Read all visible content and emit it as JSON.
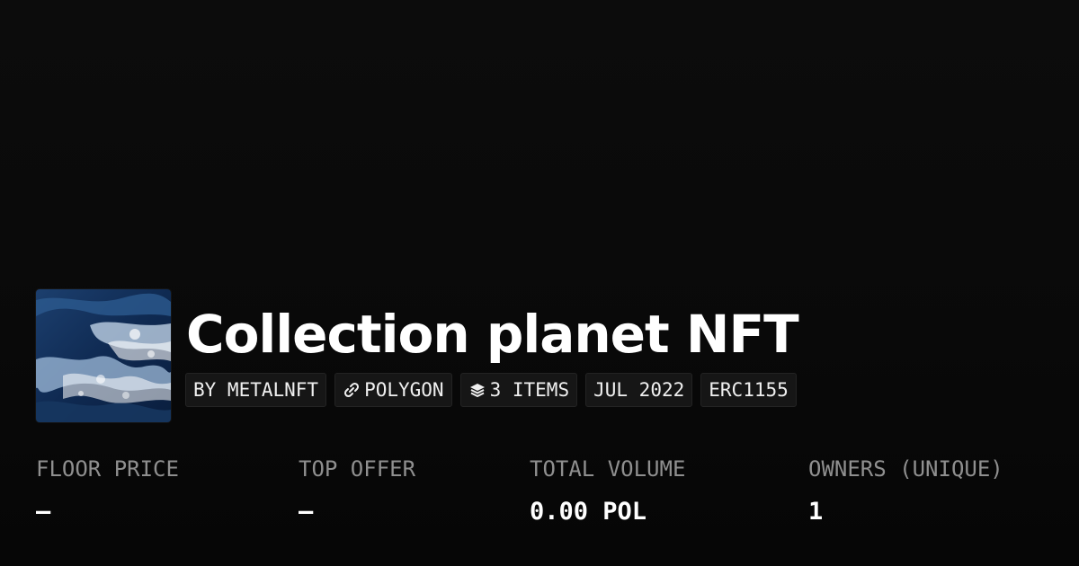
{
  "collection": {
    "title": "Collection planet NFT",
    "thumbnail_icon": "ocean-waves-image"
  },
  "chips": {
    "creator": "BY METALNFT",
    "chain": "POLYGON",
    "chain_icon": "polygon-link-icon",
    "items": "3 ITEMS",
    "items_icon": "layers-icon",
    "date": "JUL 2022",
    "standard": "ERC1155"
  },
  "stats": {
    "floor_price": {
      "label": "FLOOR PRICE",
      "value": "–"
    },
    "top_offer": {
      "label": "TOP OFFER",
      "value": "–"
    },
    "total_volume": {
      "label": "TOTAL VOLUME",
      "value": "0.00 POL"
    },
    "owners": {
      "label": "OWNERS (UNIQUE)",
      "value": "1"
    }
  },
  "colors": {
    "background": "#0b0b0b",
    "text_primary": "#ffffff",
    "text_muted": "#8f8f8f",
    "chip_background": "#161616"
  }
}
